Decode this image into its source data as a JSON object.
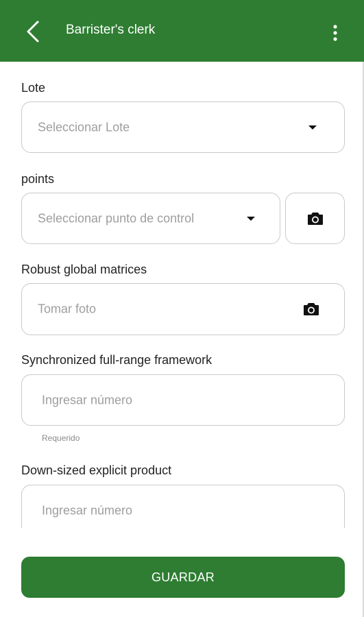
{
  "header": {
    "title": "Barrister's clerk",
    "back_icon": "chevron-left-icon",
    "menu_icon": "more-vert-icon",
    "color": "#2e7d32"
  },
  "form": {
    "lote": {
      "label": "Lote",
      "placeholder": "Seleccionar Lote"
    },
    "points": {
      "label": "points",
      "placeholder": "Seleccionar punto de control",
      "camera_icon": "camera-icon"
    },
    "robust": {
      "label": "Robust global matrices",
      "placeholder": "Tomar foto",
      "camera_icon": "camera-icon"
    },
    "synchronized": {
      "label": "Synchronized full-range framework",
      "placeholder": "Ingresar número",
      "helper": "Requerido"
    },
    "downsized": {
      "label": "Down-sized explicit product",
      "placeholder": "Ingresar número"
    }
  },
  "actions": {
    "save_label": "GUARDAR",
    "color": "#2e7d32"
  }
}
